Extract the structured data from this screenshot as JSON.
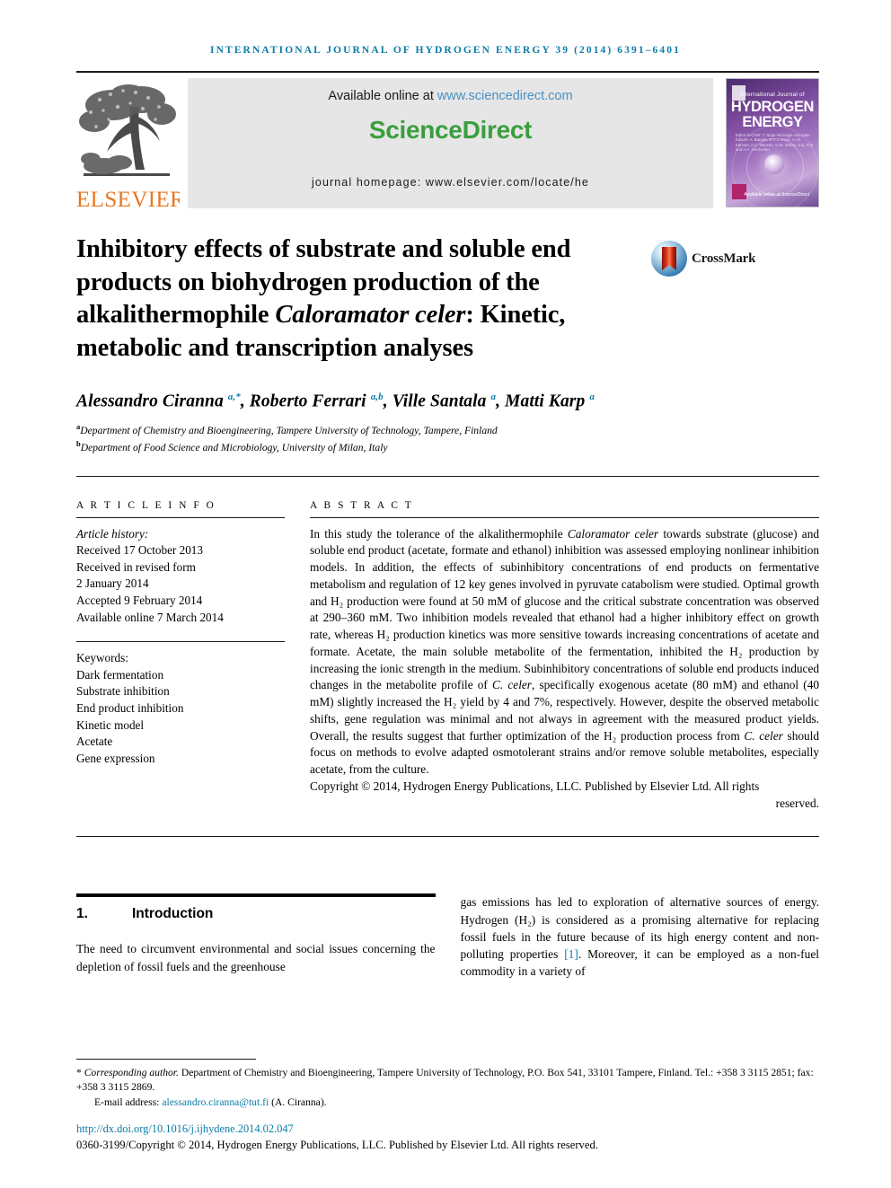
{
  "running_head": "International Journal of Hydrogen Energy 39 (2014) 6391–6401",
  "masthead": {
    "publisher": "ELSEVIER",
    "available_prefix": "Available online at ",
    "available_url": "www.sciencedirect.com",
    "sciencedirect_logo": "ScienceDirect",
    "homepage": "journal homepage: www.elsevier.com/locate/he",
    "cover": {
      "line_top": "International Journal of",
      "line_big_1": "HYDROGEN",
      "line_big_2": "ENERGY",
      "editors": "Editor-in-Chief: T. Nejat Veziroglu    Associate Editors: A. Bandini, D.A.J. Rand, A. M. Kannan, A.C. Macedo, D.W. Stefan, D.a. Frol and A.A. Yurchenko",
      "sciencedirect_mark": "Available online at\nScienceDirect"
    }
  },
  "article": {
    "title_part1": "Inhibitory effects of substrate and soluble end products on biohydrogen production of the alkalithermophile ",
    "title_italic": "Caloramator celer",
    "title_part2": ": Kinetic, metabolic and transcription analyses",
    "crossmark_label": "CrossMark",
    "authors_html": "Alessandro Ciranna <sup>a,*</sup>, Roberto Ferrari <sup>a,b</sup>, Ville Santala <sup>a</sup>, Matti Karp <sup>a</sup>",
    "affiliation_a": "Department of Chemistry and Bioengineering, Tampere University of Technology, Tampere, Finland",
    "affiliation_b": "Department of Food Science and Microbiology, University of Milan, Italy"
  },
  "article_info": {
    "heading": "A R T I C L E   I N F O",
    "history_label": "Article history:",
    "history": [
      "Received 17 October 2013",
      "Received in revised form",
      "2 January 2014",
      "Accepted 9 February 2014",
      "Available online 7 March 2014"
    ],
    "keywords_label": "Keywords:",
    "keywords": [
      "Dark fermentation",
      "Substrate inhibition",
      "End product inhibition",
      "Kinetic model",
      "Acetate",
      "Gene expression"
    ]
  },
  "abstract": {
    "heading": "A B S T R A C T",
    "text_1": "In this study the tolerance of the alkalithermophile ",
    "species_1": "Caloramator celer",
    "text_2": " towards substrate (glucose) and soluble end product (acetate, formate and ethanol) inhibition was assessed employing nonlinear inhibition models. In addition, the effects of subinhibitory concentrations of end products on fermentative metabolism and regulation of 12 key genes involved in pyruvate catabolism were studied. Optimal growth and H₂ production were found at 50 mM of glucose and the critical substrate concentration was observed at 290–360 mM. Two inhibition models revealed that ethanol had a higher inhibitory effect on growth rate, whereas H₂ production kinetics was more sensitive towards increasing concentrations of acetate and formate. Acetate, the main soluble metabolite of the fermentation, inhibited the H₂ production by increasing the ionic strength in the medium. Subinhibitory concentrations of soluble end products induced changes in the metabolite profile of ",
    "species_2": "C. celer",
    "text_3": ", specifically exogenous acetate (80 mM) and ethanol (40 mM) slightly increased the H₂ yield by 4 and 7%, respectively. However, despite the observed metabolic shifts, gene regulation was minimal and not always in agreement with the measured product yields. Overall, the results suggest that further optimization of the H₂ production process from ",
    "species_3": "C. celer",
    "text_4": " should focus on methods to evolve adapted osmotolerant strains and/or remove soluble metabolites, especially acetate, from the culture.",
    "copyright": "Copyright © 2014, Hydrogen Energy Publications, LLC. Published by Elsevier Ltd. All rights",
    "copyright_last": "reserved."
  },
  "introduction": {
    "number": "1.",
    "heading": "Introduction",
    "col_left": "The need to circumvent environmental and social issues concerning the depletion of fossil fuels and the greenhouse",
    "col_right_a": "gas emissions has led to exploration of alternative sources of energy. Hydrogen (H₂) is considered as a promising alternative for replacing fossil fuels in the future because of its high energy content and non-polluting properties ",
    "col_right_ref": "[1]",
    "col_right_b": ". Moreover, it can be employed as a non-fuel commodity in a variety of"
  },
  "footer": {
    "corresponding_marker": "*",
    "corresponding_label": "Corresponding author.",
    "corresponding_text": " Department of Chemistry and Bioengineering, Tampere University of Technology, P.O. Box 541, 33101 Tampere, Finland. Tel.: +358 3 3115 2851; fax: +358 3 3115 2869.",
    "email_label": "E-mail address: ",
    "email_address": "alessandro.ciranna@tut.fi",
    "email_suffix": " (A. Ciranna).",
    "doi": "http://dx.doi.org/10.1016/j.ijhydene.2014.02.047",
    "issn_line": "0360-3199/Copyright © 2014, Hydrogen Energy Publications, LLC. Published by Elsevier Ltd. All rights reserved."
  },
  "colors": {
    "journal_teal": "#0b7ca8",
    "elsevier_orange": "#e87722",
    "sciencedirect_green": "#3a9e3d",
    "link_blue": "#4a90c2"
  }
}
